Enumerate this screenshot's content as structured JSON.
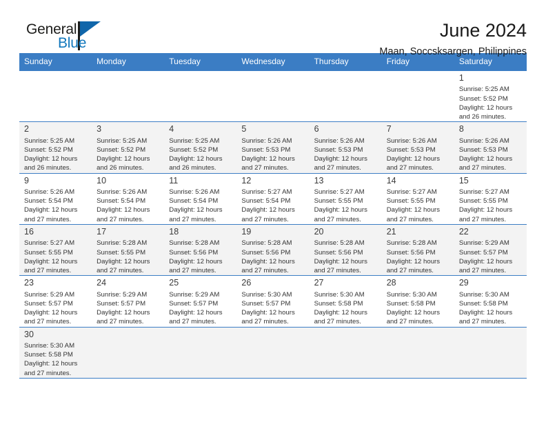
{
  "brand": {
    "name_part1": "General",
    "name_part2": "Blue",
    "accent_color": "#1077bc"
  },
  "header": {
    "title": "June 2024",
    "subtitle": "Maan, Soccsksargen, Philippines"
  },
  "calendar": {
    "header_bg": "#3b7dc4",
    "weekday_headers": [
      "Sunday",
      "Monday",
      "Tuesday",
      "Wednesday",
      "Thursday",
      "Friday",
      "Saturday"
    ],
    "labels": {
      "sunrise": "Sunrise:",
      "sunset": "Sunset:",
      "daylight": "Daylight:"
    },
    "weeks": [
      [
        {
          "day": "",
          "sunrise": "",
          "sunset": "",
          "daylight_line1": "",
          "daylight_line2": "",
          "empty": true
        },
        {
          "day": "",
          "sunrise": "",
          "sunset": "",
          "daylight_line1": "",
          "daylight_line2": "",
          "empty": true
        },
        {
          "day": "",
          "sunrise": "",
          "sunset": "",
          "daylight_line1": "",
          "daylight_line2": "",
          "empty": true
        },
        {
          "day": "",
          "sunrise": "",
          "sunset": "",
          "daylight_line1": "",
          "daylight_line2": "",
          "empty": true
        },
        {
          "day": "",
          "sunrise": "",
          "sunset": "",
          "daylight_line1": "",
          "daylight_line2": "",
          "empty": true
        },
        {
          "day": "",
          "sunrise": "",
          "sunset": "",
          "daylight_line1": "",
          "daylight_line2": "",
          "empty": true
        },
        {
          "day": "1",
          "sunrise": "Sunrise: 5:25 AM",
          "sunset": "Sunset: 5:52 PM",
          "daylight_line1": "Daylight: 12 hours",
          "daylight_line2": "and 26 minutes.",
          "empty": false
        }
      ],
      [
        {
          "day": "2",
          "sunrise": "Sunrise: 5:25 AM",
          "sunset": "Sunset: 5:52 PM",
          "daylight_line1": "Daylight: 12 hours",
          "daylight_line2": "and 26 minutes.",
          "empty": false
        },
        {
          "day": "3",
          "sunrise": "Sunrise: 5:25 AM",
          "sunset": "Sunset: 5:52 PM",
          "daylight_line1": "Daylight: 12 hours",
          "daylight_line2": "and 26 minutes.",
          "empty": false
        },
        {
          "day": "4",
          "sunrise": "Sunrise: 5:25 AM",
          "sunset": "Sunset: 5:52 PM",
          "daylight_line1": "Daylight: 12 hours",
          "daylight_line2": "and 26 minutes.",
          "empty": false
        },
        {
          "day": "5",
          "sunrise": "Sunrise: 5:26 AM",
          "sunset": "Sunset: 5:53 PM",
          "daylight_line1": "Daylight: 12 hours",
          "daylight_line2": "and 27 minutes.",
          "empty": false
        },
        {
          "day": "6",
          "sunrise": "Sunrise: 5:26 AM",
          "sunset": "Sunset: 5:53 PM",
          "daylight_line1": "Daylight: 12 hours",
          "daylight_line2": "and 27 minutes.",
          "empty": false
        },
        {
          "day": "7",
          "sunrise": "Sunrise: 5:26 AM",
          "sunset": "Sunset: 5:53 PM",
          "daylight_line1": "Daylight: 12 hours",
          "daylight_line2": "and 27 minutes.",
          "empty": false
        },
        {
          "day": "8",
          "sunrise": "Sunrise: 5:26 AM",
          "sunset": "Sunset: 5:53 PM",
          "daylight_line1": "Daylight: 12 hours",
          "daylight_line2": "and 27 minutes.",
          "empty": false
        }
      ],
      [
        {
          "day": "9",
          "sunrise": "Sunrise: 5:26 AM",
          "sunset": "Sunset: 5:54 PM",
          "daylight_line1": "Daylight: 12 hours",
          "daylight_line2": "and 27 minutes.",
          "empty": false
        },
        {
          "day": "10",
          "sunrise": "Sunrise: 5:26 AM",
          "sunset": "Sunset: 5:54 PM",
          "daylight_line1": "Daylight: 12 hours",
          "daylight_line2": "and 27 minutes.",
          "empty": false
        },
        {
          "day": "11",
          "sunrise": "Sunrise: 5:26 AM",
          "sunset": "Sunset: 5:54 PM",
          "daylight_line1": "Daylight: 12 hours",
          "daylight_line2": "and 27 minutes.",
          "empty": false
        },
        {
          "day": "12",
          "sunrise": "Sunrise: 5:27 AM",
          "sunset": "Sunset: 5:54 PM",
          "daylight_line1": "Daylight: 12 hours",
          "daylight_line2": "and 27 minutes.",
          "empty": false
        },
        {
          "day": "13",
          "sunrise": "Sunrise: 5:27 AM",
          "sunset": "Sunset: 5:55 PM",
          "daylight_line1": "Daylight: 12 hours",
          "daylight_line2": "and 27 minutes.",
          "empty": false
        },
        {
          "day": "14",
          "sunrise": "Sunrise: 5:27 AM",
          "sunset": "Sunset: 5:55 PM",
          "daylight_line1": "Daylight: 12 hours",
          "daylight_line2": "and 27 minutes.",
          "empty": false
        },
        {
          "day": "15",
          "sunrise": "Sunrise: 5:27 AM",
          "sunset": "Sunset: 5:55 PM",
          "daylight_line1": "Daylight: 12 hours",
          "daylight_line2": "and 27 minutes.",
          "empty": false
        }
      ],
      [
        {
          "day": "16",
          "sunrise": "Sunrise: 5:27 AM",
          "sunset": "Sunset: 5:55 PM",
          "daylight_line1": "Daylight: 12 hours",
          "daylight_line2": "and 27 minutes.",
          "empty": false
        },
        {
          "day": "17",
          "sunrise": "Sunrise: 5:28 AM",
          "sunset": "Sunset: 5:55 PM",
          "daylight_line1": "Daylight: 12 hours",
          "daylight_line2": "and 27 minutes.",
          "empty": false
        },
        {
          "day": "18",
          "sunrise": "Sunrise: 5:28 AM",
          "sunset": "Sunset: 5:56 PM",
          "daylight_line1": "Daylight: 12 hours",
          "daylight_line2": "and 27 minutes.",
          "empty": false
        },
        {
          "day": "19",
          "sunrise": "Sunrise: 5:28 AM",
          "sunset": "Sunset: 5:56 PM",
          "daylight_line1": "Daylight: 12 hours",
          "daylight_line2": "and 27 minutes.",
          "empty": false
        },
        {
          "day": "20",
          "sunrise": "Sunrise: 5:28 AM",
          "sunset": "Sunset: 5:56 PM",
          "daylight_line1": "Daylight: 12 hours",
          "daylight_line2": "and 27 minutes.",
          "empty": false
        },
        {
          "day": "21",
          "sunrise": "Sunrise: 5:28 AM",
          "sunset": "Sunset: 5:56 PM",
          "daylight_line1": "Daylight: 12 hours",
          "daylight_line2": "and 27 minutes.",
          "empty": false
        },
        {
          "day": "22",
          "sunrise": "Sunrise: 5:29 AM",
          "sunset": "Sunset: 5:57 PM",
          "daylight_line1": "Daylight: 12 hours",
          "daylight_line2": "and 27 minutes.",
          "empty": false
        }
      ],
      [
        {
          "day": "23",
          "sunrise": "Sunrise: 5:29 AM",
          "sunset": "Sunset: 5:57 PM",
          "daylight_line1": "Daylight: 12 hours",
          "daylight_line2": "and 27 minutes.",
          "empty": false
        },
        {
          "day": "24",
          "sunrise": "Sunrise: 5:29 AM",
          "sunset": "Sunset: 5:57 PM",
          "daylight_line1": "Daylight: 12 hours",
          "daylight_line2": "and 27 minutes.",
          "empty": false
        },
        {
          "day": "25",
          "sunrise": "Sunrise: 5:29 AM",
          "sunset": "Sunset: 5:57 PM",
          "daylight_line1": "Daylight: 12 hours",
          "daylight_line2": "and 27 minutes.",
          "empty": false
        },
        {
          "day": "26",
          "sunrise": "Sunrise: 5:30 AM",
          "sunset": "Sunset: 5:57 PM",
          "daylight_line1": "Daylight: 12 hours",
          "daylight_line2": "and 27 minutes.",
          "empty": false
        },
        {
          "day": "27",
          "sunrise": "Sunrise: 5:30 AM",
          "sunset": "Sunset: 5:58 PM",
          "daylight_line1": "Daylight: 12 hours",
          "daylight_line2": "and 27 minutes.",
          "empty": false
        },
        {
          "day": "28",
          "sunrise": "Sunrise: 5:30 AM",
          "sunset": "Sunset: 5:58 PM",
          "daylight_line1": "Daylight: 12 hours",
          "daylight_line2": "and 27 minutes.",
          "empty": false
        },
        {
          "day": "29",
          "sunrise": "Sunrise: 5:30 AM",
          "sunset": "Sunset: 5:58 PM",
          "daylight_line1": "Daylight: 12 hours",
          "daylight_line2": "and 27 minutes.",
          "empty": false
        }
      ],
      [
        {
          "day": "30",
          "sunrise": "Sunrise: 5:30 AM",
          "sunset": "Sunset: 5:58 PM",
          "daylight_line1": "Daylight: 12 hours",
          "daylight_line2": "and 27 minutes.",
          "empty": false
        },
        {
          "day": "",
          "sunrise": "",
          "sunset": "",
          "daylight_line1": "",
          "daylight_line2": "",
          "empty": true
        },
        {
          "day": "",
          "sunrise": "",
          "sunset": "",
          "daylight_line1": "",
          "daylight_line2": "",
          "empty": true
        },
        {
          "day": "",
          "sunrise": "",
          "sunset": "",
          "daylight_line1": "",
          "daylight_line2": "",
          "empty": true
        },
        {
          "day": "",
          "sunrise": "",
          "sunset": "",
          "daylight_line1": "",
          "daylight_line2": "",
          "empty": true
        },
        {
          "day": "",
          "sunrise": "",
          "sunset": "",
          "daylight_line1": "",
          "daylight_line2": "",
          "empty": true
        },
        {
          "day": "",
          "sunrise": "",
          "sunset": "",
          "daylight_line1": "",
          "daylight_line2": "",
          "empty": true
        }
      ]
    ]
  }
}
